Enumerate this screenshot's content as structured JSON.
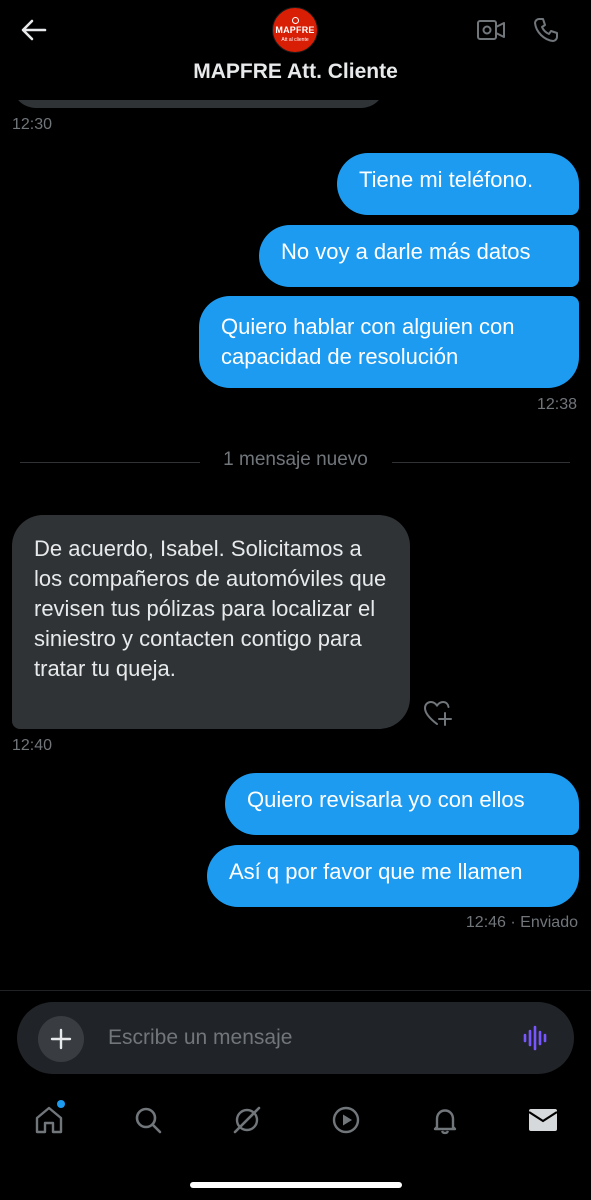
{
  "header": {
    "title": "MAPFRE Att. Cliente",
    "avatar_brand": "MAPFRE",
    "avatar_sub": "Att al cliente"
  },
  "messages": {
    "prev_time": "12:30",
    "m1": "Tiene mi teléfono.",
    "m2": "No voy a darle más datos",
    "m3": "Quiero hablar con alguien con capacidad de resolución",
    "t1": "12:38",
    "divider": "1 mensaje nuevo",
    "m4": "De acuerdo, Isabel. Solicitamos a los compañeros de automóviles que revisen tus pólizas para localizar el siniestro y contacten contigo para tratar tu queja.",
    "t2": "12:40",
    "m5": "Quiero revisarla yo con ellos",
    "m6": "Así q por favor que me llamen",
    "t3": "12:46",
    "status": "· Enviado"
  },
  "composer": {
    "placeholder": "Escribe un mensaje"
  },
  "colors": {
    "accent": "#1d9bf0",
    "incoming": "#2f3336",
    "brand_red": "#d81e05",
    "voice": "#7856ff"
  },
  "icons": [
    "back-arrow-icon",
    "video-call-icon",
    "phone-icon",
    "plus-icon",
    "voice-wave-icon",
    "home-icon",
    "search-icon",
    "grok-icon",
    "video-icon",
    "bell-icon",
    "mail-icon",
    "heart-plus-icon"
  ]
}
